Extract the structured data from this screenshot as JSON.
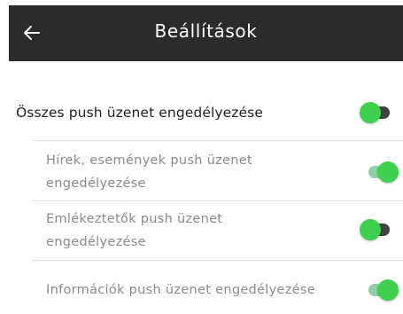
{
  "header": {
    "title": "Beállítások",
    "back_icon": "arrow-left-icon"
  },
  "colors": {
    "header_bg": "#2b2b2b",
    "toggle_green": "#3fd04f",
    "track_dark": "#424242",
    "track_light_green": "#8ecfa4"
  },
  "settings": [
    {
      "label": "Összes push üzenet engedélyezése",
      "track_color": "#424242"
    },
    {
      "label_lines": [
        "Hírek, események push üzenet",
        "engedélyezése"
      ],
      "track_color": "#8ecfa4"
    },
    {
      "label_lines": [
        "Emlékeztetők push üzenet",
        "engedélyezése"
      ],
      "track_color": "#424242"
    },
    {
      "label": "Információk push üzenet engedélyezése",
      "track_color": "#8ecfa4"
    }
  ]
}
